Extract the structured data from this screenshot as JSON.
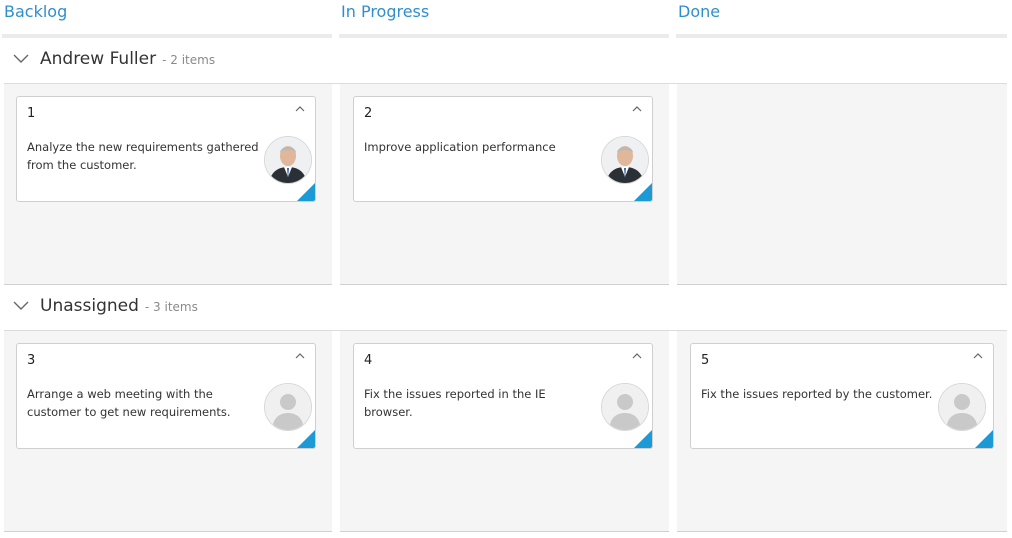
{
  "columns": [
    {
      "title": "Backlog"
    },
    {
      "title": "In Progress"
    },
    {
      "title": "Done"
    }
  ],
  "swimlanes": [
    {
      "name": "Andrew Fuller",
      "count": "- 2 items"
    },
    {
      "name": "Unassigned",
      "count": "- 3 items"
    }
  ],
  "cards": [
    {
      "id": "1",
      "text": "Analyze the new requirements gathered from the customer.",
      "assignee": "photo"
    },
    {
      "id": "2",
      "text": "Improve application performance",
      "assignee": "photo"
    },
    {
      "id": "3",
      "text": "Arrange a web meeting with the customer to get new requirements.",
      "assignee": "placeholder"
    },
    {
      "id": "4",
      "text": "Fix the issues reported in the IE browser.",
      "assignee": "placeholder"
    },
    {
      "id": "5",
      "text": "Fix the issues reported by the customer.",
      "assignee": "placeholder"
    }
  ],
  "colors": {
    "accent": "#1b9ad6",
    "header_text": "#2f8fce",
    "cell_bg": "#f5f5f5"
  }
}
